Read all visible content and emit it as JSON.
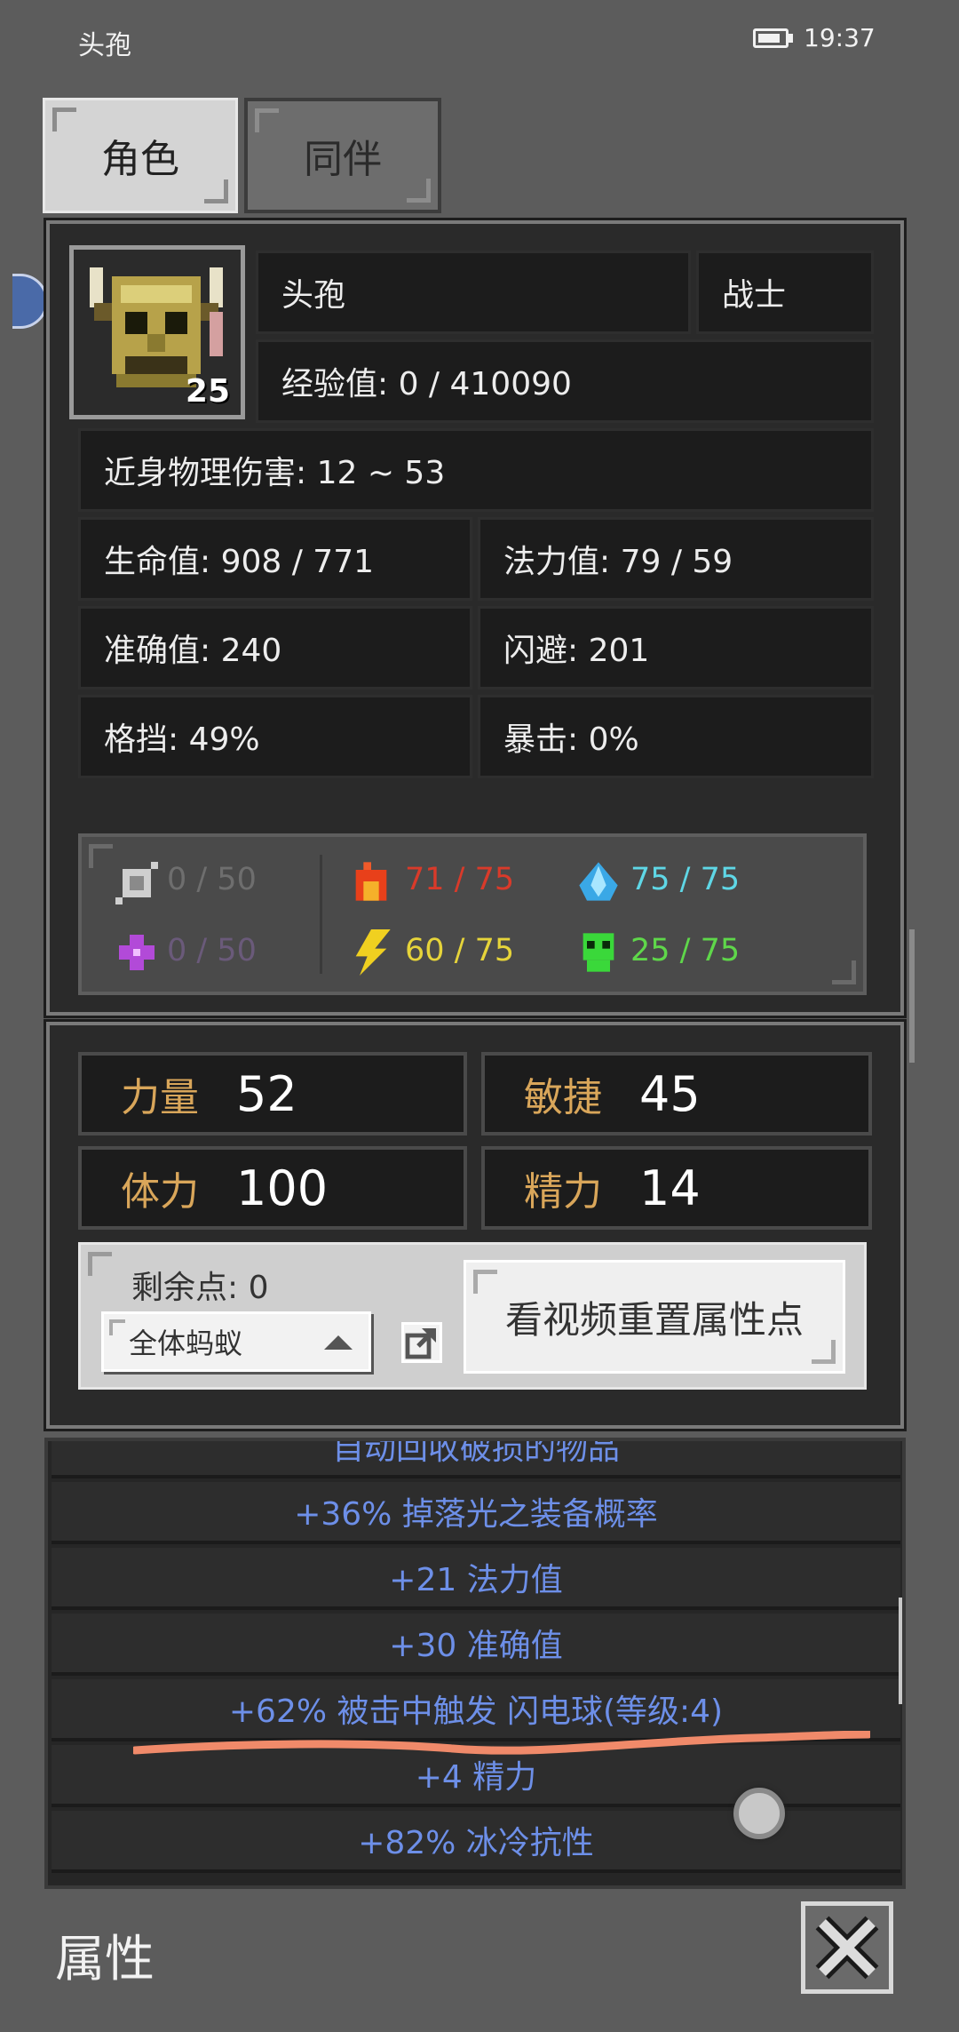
{
  "status_bar": {
    "title": "头孢",
    "time": "19:37"
  },
  "tabs": [
    {
      "label": "角色",
      "active": true
    },
    {
      "label": "同伴",
      "active": false
    }
  ],
  "character": {
    "name": "头孢",
    "class": "战士",
    "level": "25",
    "experience": "经验值: 0 / 410090",
    "melee_damage": "近身物理伤害: 12 ~ 53",
    "stats": {
      "hp": "生命值: 908 / 771",
      "mp": "法力值: 79 / 59",
      "accuracy": "准确值: 240",
      "dodge": "闪避: 201",
      "block": "格挡: 49%",
      "crit": "暴击: 0%"
    }
  },
  "resistances": {
    "physical": {
      "icon": "physical-shield-icon",
      "value": "0 / 50",
      "color": "#6e6e6e"
    },
    "arcane": {
      "icon": "arcane-star-icon",
      "value": "0 / 50",
      "color": "#6a5a7a"
    },
    "fire": {
      "icon": "fire-icon",
      "value": "71 / 75",
      "color": "#d93a2a"
    },
    "lightning": {
      "icon": "lightning-icon",
      "value": "60 / 75",
      "color": "#e6d43a"
    },
    "ice": {
      "icon": "ice-crystal-icon",
      "value": "75 / 75",
      "color": "#5fd7e6"
    },
    "poison": {
      "icon": "poison-skull-icon",
      "value": "25 / 75",
      "color": "#5fd74a"
    }
  },
  "attributes": [
    {
      "label": "力量",
      "value": "52"
    },
    {
      "label": "敏捷",
      "value": "45"
    },
    {
      "label": "体力",
      "value": "100"
    },
    {
      "label": "精力",
      "value": "14"
    }
  ],
  "points": {
    "remaining": "剩余点: 0",
    "target_select": "全体蚂蚁",
    "reset_button": "看视频重置属性点"
  },
  "item_properties": [
    "自动回收破损的物品",
    "+36% 掉落光之装备概率",
    "+21 法力值",
    "+30 准确值",
    "+62% 被击中触发 闪电球(等级:4)",
    "+4 精力",
    "+82% 冰冷抗性"
  ],
  "bottom": {
    "title": "属性"
  }
}
